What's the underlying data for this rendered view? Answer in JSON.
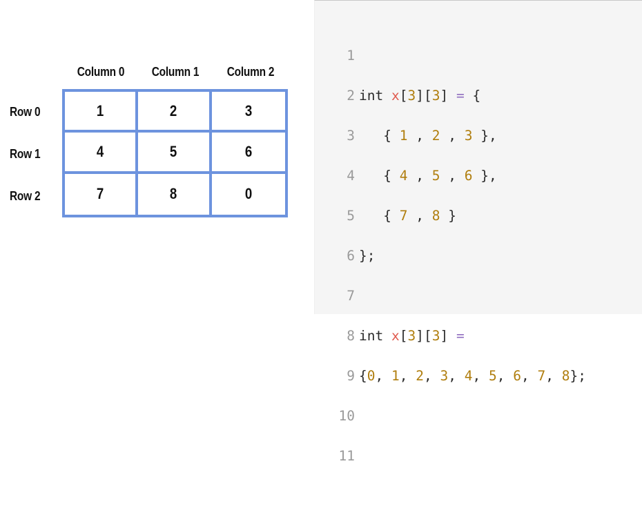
{
  "diagram": {
    "column_headers": [
      "Column 0",
      "Column 1",
      "Column 2"
    ],
    "row_headers": [
      "Row 0",
      "Row 1",
      "Row 2"
    ],
    "cells": [
      [
        "1",
        "2",
        "3"
      ],
      [
        "4",
        "5",
        "6"
      ],
      [
        "7",
        "8",
        "0"
      ]
    ],
    "border_color": "#6d93de"
  },
  "code": {
    "line_numbers": [
      "1",
      "2",
      "3",
      "4",
      "5",
      "6",
      "7",
      "8",
      "9",
      "10",
      "11"
    ],
    "tokens": {
      "type": "int",
      "var": "x",
      "dims": [
        "3",
        "3"
      ],
      "row0": [
        "1",
        "2",
        "3"
      ],
      "row1": [
        "4",
        "5",
        "6"
      ],
      "row2": [
        "7",
        "8"
      ],
      "flat": [
        "0",
        "1",
        "2",
        "3",
        "4",
        "5",
        "6",
        "7",
        "8"
      ]
    },
    "colors": {
      "variable": "#e05a4e",
      "number": "#b07e0e",
      "operator": "#8f6dbf",
      "line_number": "#9a9a9a"
    }
  }
}
